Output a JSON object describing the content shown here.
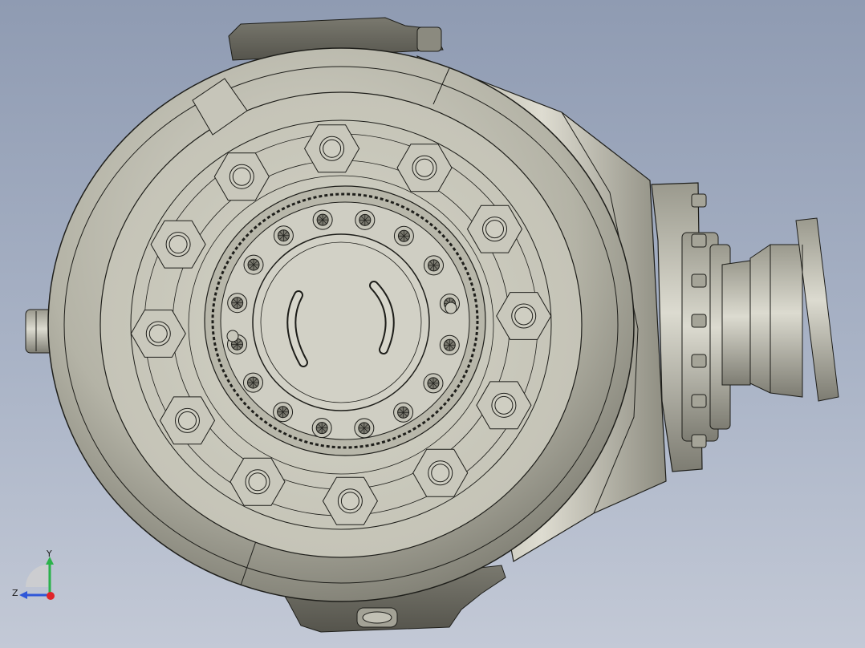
{
  "viewport": {
    "background_top": "#8f9bb2",
    "background_bottom": "#c3c9d6",
    "model_color": "#b9b8ab",
    "edge_color": "#1e1e1a"
  },
  "triad": {
    "y_label": "Y",
    "z_label": "Z",
    "y_axis_color": "#2bb24a",
    "z_axis_color": "#2f57d8",
    "x_axis_color": "#e0242a"
  }
}
